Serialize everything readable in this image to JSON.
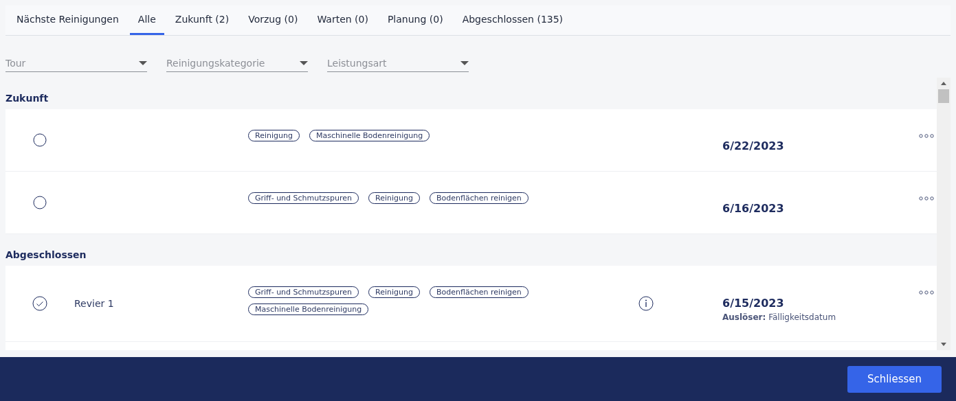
{
  "tabs": [
    {
      "label": "Nächste Reinigungen",
      "selected": false
    },
    {
      "label": "Alle",
      "selected": true
    },
    {
      "label": "Zukunft (2)",
      "selected": false
    },
    {
      "label": "Vorzug (0)",
      "selected": false
    },
    {
      "label": "Warten (0)",
      "selected": false
    },
    {
      "label": "Planung (0)",
      "selected": false
    },
    {
      "label": "Abgeschlossen (135)",
      "selected": false
    }
  ],
  "filters": [
    {
      "placeholder": "Tour"
    },
    {
      "placeholder": "Reinigungskategorie"
    },
    {
      "placeholder": "Leistungsart"
    }
  ],
  "sections": [
    {
      "title": "Zukunft",
      "rows": [
        {
          "done": false,
          "name": "",
          "tags": [
            "Reinigung",
            "Maschinelle Bodenreinigung"
          ],
          "info": false,
          "date": "6/22/2023"
        },
        {
          "done": false,
          "name": "",
          "tags": [
            "Griff- und Schmutzspuren",
            "Reinigung",
            "Bodenflächen reinigen"
          ],
          "info": false,
          "date": "6/16/2023"
        }
      ]
    },
    {
      "title": "Abgeschlossen",
      "rows": [
        {
          "done": true,
          "name": "Revier 1",
          "tags": [
            "Griff- und Schmutzspuren",
            "Reinigung",
            "Bodenflächen reinigen",
            "Maschinelle Bodenreinigung"
          ],
          "info": true,
          "date": "6/15/2023",
          "trigger": "**Auslöser:** Fälligkeitsdatum"
        }
      ]
    }
  ],
  "footer": {
    "button": "Schliessen"
  }
}
